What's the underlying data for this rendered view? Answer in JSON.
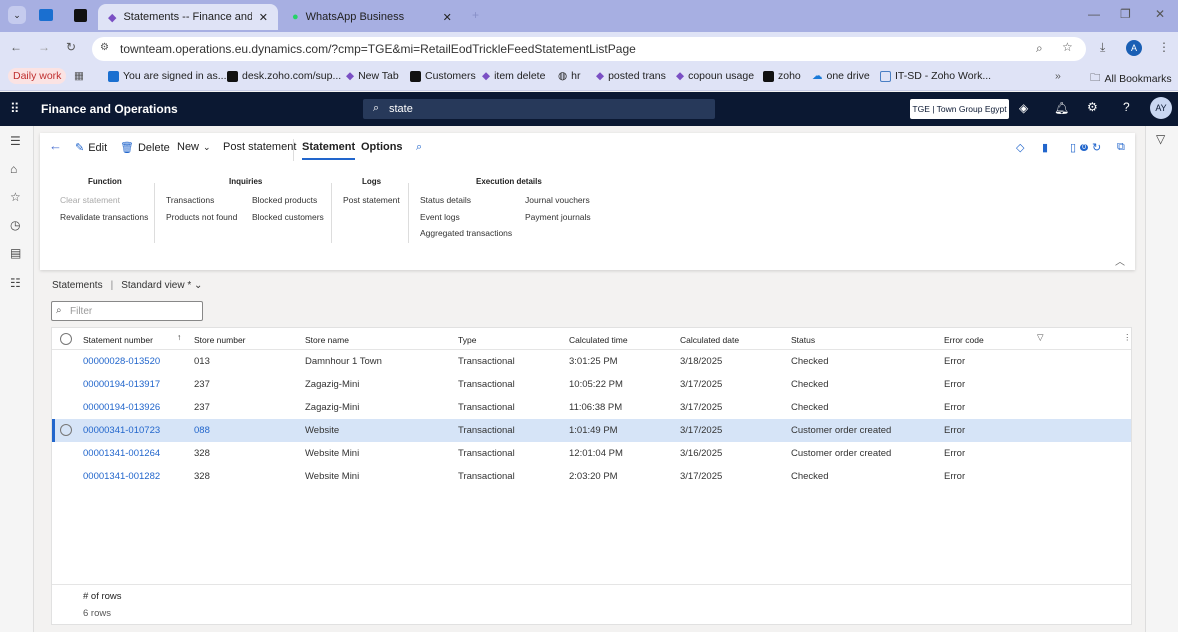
{
  "browser": {
    "tabs": [
      {
        "label": "Statements -- Finance and Ope",
        "active": true
      },
      {
        "label": "WhatsApp Business",
        "active": false
      }
    ],
    "url": "townteam.operations.eu.dynamics.com/?cmp=TGE&mi=RetailEodTrickleFeedStatementListPage",
    "profile_initial": "A",
    "bookmarks": [
      "Daily work",
      "You are signed in as...",
      "desk.zoho.com/sup...",
      "New Tab",
      "Customers",
      "item delete",
      "hr",
      "posted trans",
      "copoun usage",
      "zoho",
      "one drive",
      "IT-SD - Zoho Work..."
    ],
    "all_bookmarks": "All Bookmarks"
  },
  "app": {
    "title": "Finance and Operations",
    "search_value": "state",
    "company": "TGE | Town Group Egypt",
    "avatar": "AY",
    "notification_count": "0"
  },
  "toolbar": {
    "edit": "Edit",
    "delete": "Delete",
    "new": "New",
    "post_statement": "Post statement",
    "tab_statement": "Statement",
    "tab_options": "Options"
  },
  "ribbon": {
    "function": {
      "title": "Function",
      "items": [
        "Clear statement",
        "Revalidate transactions"
      ]
    },
    "inquiries": {
      "title": "Inquiries",
      "items": [
        "Transactions",
        "Products not found",
        "Blocked products",
        "Blocked customers"
      ]
    },
    "logs": {
      "title": "Logs",
      "items": [
        "Post statement"
      ]
    },
    "execution": {
      "title": "Execution details",
      "items": [
        "Status details",
        "Event logs",
        "Aggregated transactions",
        "Journal vouchers",
        "Payment journals"
      ]
    }
  },
  "list": {
    "breadcrumb": "Statements",
    "view": "Standard view *",
    "filter_placeholder": "Filter",
    "columns": [
      "Statement number",
      "Store number",
      "Store name",
      "Type",
      "Calculated time",
      "Calculated date",
      "Status",
      "Error code"
    ],
    "rows": [
      [
        "00000028-013520",
        "013",
        "Damnhour 1 Town",
        "Transactional",
        "3:01:25 PM",
        "3/18/2025",
        "Checked",
        "Error"
      ],
      [
        "00000194-013917",
        "237",
        "Zagazig-Mini",
        "Transactional",
        "10:05:22 PM",
        "3/17/2025",
        "Checked",
        "Error"
      ],
      [
        "00000194-013926",
        "237",
        "Zagazig-Mini",
        "Transactional",
        "11:06:38 PM",
        "3/17/2025",
        "Checked",
        "Error"
      ],
      [
        "00000341-010723",
        "088",
        "Website",
        "Transactional",
        "1:01:49 PM",
        "3/17/2025",
        "Customer order created",
        "Error"
      ],
      [
        "00001341-001264",
        "328",
        "Website Mini",
        "Transactional",
        "12:01:04 PM",
        "3/16/2025",
        "Customer order created",
        "Error"
      ],
      [
        "00001341-001282",
        "328",
        "Website Mini",
        "Transactional",
        "2:03:20 PM",
        "3/17/2025",
        "Checked",
        "Error"
      ]
    ],
    "selected_row": 3,
    "footer_label": "# of rows",
    "footer_value": "6 rows"
  }
}
